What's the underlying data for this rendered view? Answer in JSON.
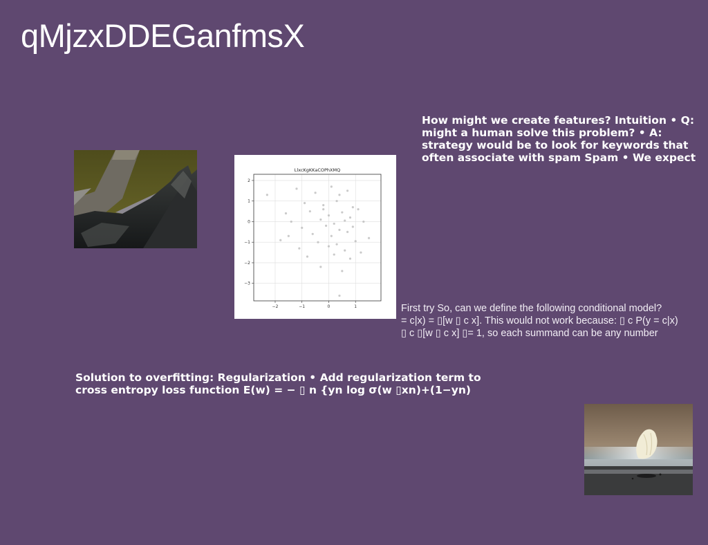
{
  "slide": {
    "title": "qMjzxDDEGanfmsX",
    "background_color": "#5f4870",
    "text_color": "#ffffff"
  },
  "blocks": {
    "features": "How might we create features? Intuition • Q:\nmight a human solve this problem? • A:\nstrategy would be to look for keywords that\noften associate with spam Spam • We expect",
    "first_try": "First try So, can we define the following conditional model?\n= c|x) = ▯[w ▯ c x]. This would not work because: ▯ c P(y = c|x)\n▯ c ▯[w ▯ c x] ▯= 1, so each summand can be any number",
    "regularization": "Solution to overfitting: Regularization • Add regularization term to\ncross entropy loss function E(w) = − ▯ n {yn log σ(w ▯xn)+(1−yn)"
  },
  "images": {
    "rocks_photo": "photo of dark rocks and a stone slab",
    "shell_photo": "photo of a white shell on a beach at dusk"
  },
  "chart_data": {
    "type": "scatter",
    "title": "LlxcKgKKaCOPhXMQ",
    "xlabel": "",
    "ylabel": "",
    "xlim": [
      -2.8,
      1.95
    ],
    "ylim": [
      -3.85,
      2.3
    ],
    "xticks": [
      -2,
      -1,
      0,
      1
    ],
    "yticks": [
      2,
      1,
      0,
      -1,
      -2,
      -3
    ],
    "xtick_labels": [
      "−2",
      "−1",
      "0",
      "1"
    ],
    "ytick_labels": [
      "2",
      "1",
      "0",
      "−1",
      "−2",
      "−3"
    ],
    "grid": true,
    "point_color": "#b8b8b8",
    "x": [
      -1.2,
      -0.5,
      0.1,
      0.4,
      0.7,
      -0.9,
      -0.2,
      0.3,
      0.9,
      1.1,
      -1.6,
      -0.7,
      0.0,
      0.5,
      0.8,
      -2.3,
      -1.4,
      -0.3,
      0.2,
      0.6,
      1.3,
      -1.0,
      -0.1,
      0.4,
      0.9,
      -0.6,
      0.1,
      0.7,
      1.5,
      -1.8,
      -0.4,
      0.3,
      1.0,
      -1.1,
      0.0,
      0.6,
      -0.8,
      0.2,
      0.8,
      -0.3,
      0.5,
      1.2,
      -1.5,
      -0.2,
      0.4
    ],
    "y": [
      1.6,
      1.4,
      1.7,
      1.3,
      1.5,
      0.9,
      0.8,
      1.0,
      0.7,
      0.6,
      0.4,
      0.5,
      0.3,
      0.45,
      0.2,
      1.3,
      0.0,
      0.1,
      -0.1,
      0.05,
      0.0,
      -0.3,
      -0.2,
      -0.4,
      -0.25,
      -0.6,
      -0.7,
      -0.5,
      -0.8,
      -0.9,
      -1.0,
      -1.1,
      -0.95,
      -1.3,
      -1.2,
      -1.4,
      -1.7,
      -1.6,
      -1.8,
      -2.2,
      -2.4,
      -1.5,
      -0.7,
      0.6,
      -3.6
    ]
  }
}
